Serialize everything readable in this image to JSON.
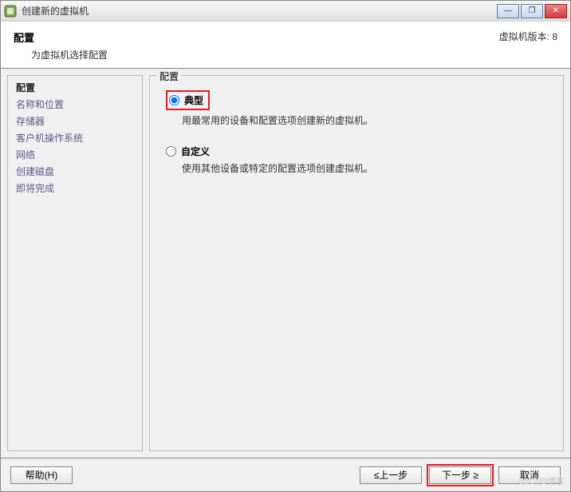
{
  "titlebar": {
    "title": "创建新的虚拟机",
    "icon": "vm-wizard-icon"
  },
  "header": {
    "title": "配置",
    "subtitle": "为虚拟机选择配置",
    "version_label": "虚拟机版本: 8"
  },
  "sidebar": {
    "steps": [
      "配置",
      "名称和位置",
      "存储器",
      "客户机操作系统",
      "网络",
      "创建磁盘",
      "即将完成"
    ],
    "current_index": 0
  },
  "content": {
    "legend": "配置",
    "options": [
      {
        "label": "典型",
        "desc": "用最常用的设备和配置选项创建新的虚拟机。",
        "selected": true,
        "highlighted": true
      },
      {
        "label": "自定义",
        "desc": "使用其他设备或特定的配置选项创建虚拟机。",
        "selected": false,
        "highlighted": false
      }
    ]
  },
  "footer": {
    "help": "帮助(H)",
    "back": "≤上一步",
    "next": "下一步 ≥",
    "cancel": "取消"
  },
  "watermark": "51CTO博客"
}
